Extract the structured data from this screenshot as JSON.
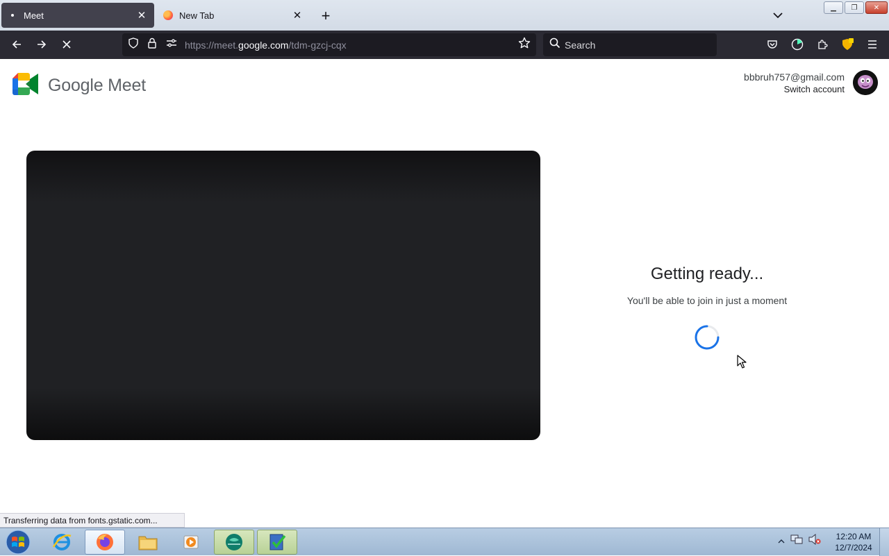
{
  "browser": {
    "tabs": [
      {
        "title": "Meet",
        "active": true
      },
      {
        "title": "New Tab",
        "active": false
      }
    ],
    "url": {
      "prefix": "https://meet.",
      "domain": "google.com",
      "path": "/tdm-gzcj-cqx"
    },
    "search_placeholder": "Search",
    "status_text": "Transferring data from fonts.gstatic.com..."
  },
  "page": {
    "logo_text": "Google Meet",
    "account": {
      "email": "bbbruh757@gmail.com",
      "switch_label": "Switch account"
    },
    "ready_title": "Getting ready...",
    "ready_subtitle": "You'll be able to join in just a moment"
  },
  "taskbar": {
    "clock_time": "12:20 AM",
    "clock_date": "12/7/2024"
  },
  "colors": {
    "accent_blue": "#1a73e8",
    "firefox_chrome": "#2b2a33"
  }
}
